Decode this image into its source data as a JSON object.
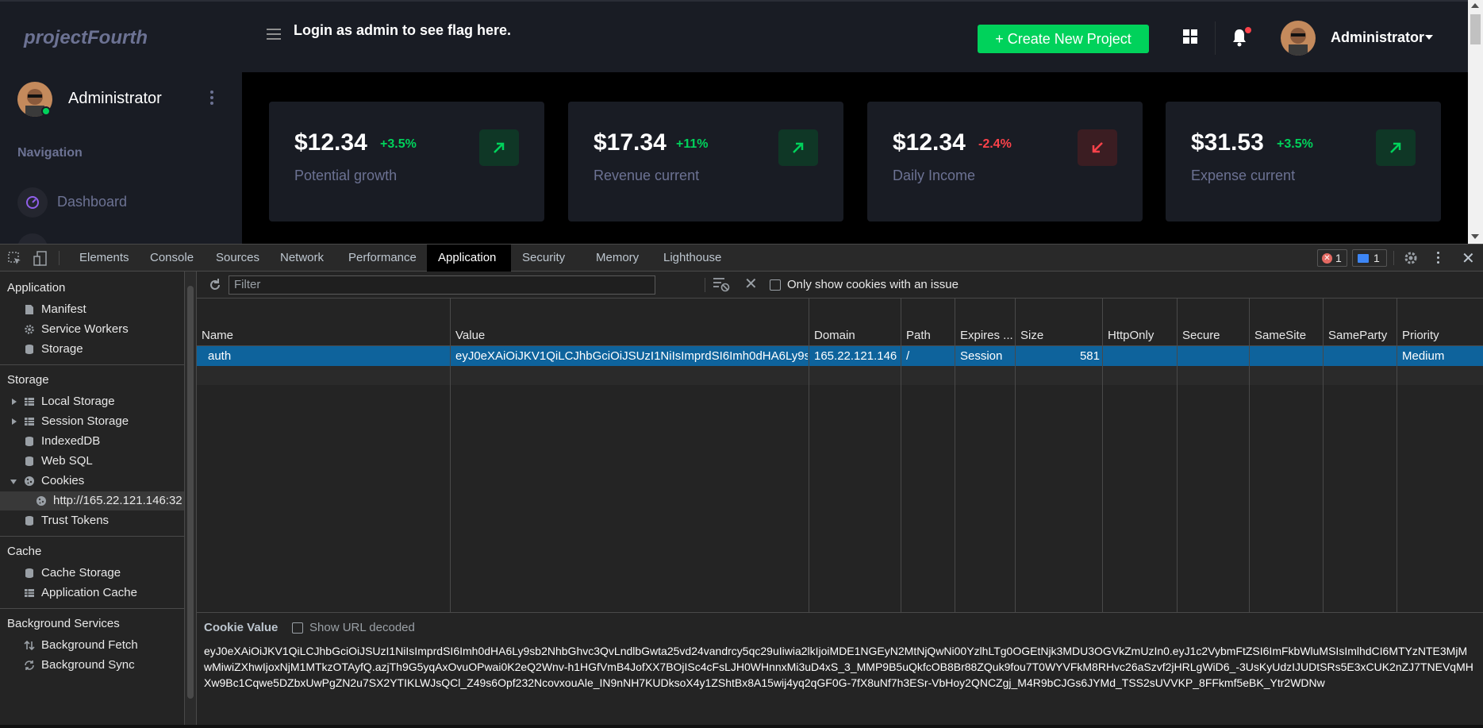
{
  "app": {
    "logo": "projectFourth",
    "flag_message": "Login as admin to see flag here.",
    "create_button": "+ Create New Project",
    "top_user": "Administrator",
    "sidebar": {
      "user_name": "Administrator",
      "section_label": "Navigation",
      "items": [
        {
          "label": "Dashboard"
        }
      ]
    },
    "cards": [
      {
        "amount": "$12.34",
        "change": "+3.5%",
        "label": "Potential growth",
        "trend": "up"
      },
      {
        "amount": "$17.34",
        "change": "+11%",
        "label": "Revenue current",
        "trend": "up"
      },
      {
        "amount": "$12.34",
        "change": "-2.4%",
        "label": "Daily Income",
        "trend": "down"
      },
      {
        "amount": "$31.53",
        "change": "+3.5%",
        "label": "Expense current",
        "trend": "up"
      }
    ],
    "colors": {
      "accent_green": "#00d25b",
      "accent_red": "#fc424a",
      "muted": "#6c7293",
      "panel": "#191c24"
    }
  },
  "devtools": {
    "tabs": [
      "Elements",
      "Console",
      "Sources",
      "Network",
      "Performance",
      "Application",
      "Security",
      "Memory",
      "Lighthouse"
    ],
    "active_tab": "Application",
    "error_count": "1",
    "message_count": "1",
    "left_panel": {
      "application_heading": "Application",
      "application_items": [
        "Manifest",
        "Service Workers",
        "Storage"
      ],
      "storage_heading": "Storage",
      "storage_items": [
        "Local Storage",
        "Session Storage",
        "IndexedDB",
        "Web SQL",
        "Cookies"
      ],
      "cookie_origin": "http://165.22.121.146:32",
      "trust_tokens": "Trust Tokens",
      "cache_heading": "Cache",
      "cache_items": [
        "Cache Storage",
        "Application Cache"
      ],
      "background_heading": "Background Services",
      "background_items": [
        "Background Fetch",
        "Background Sync"
      ]
    },
    "cookies": {
      "filter_placeholder": "Filter",
      "only_issues_label": "Only show cookies with an issue",
      "columns": [
        "Name",
        "Value",
        "Domain",
        "Path",
        "Expires ...",
        "Size",
        "HttpOnly",
        "Secure",
        "SameSite",
        "SameParty",
        "Priority"
      ],
      "rows": [
        {
          "name": "auth",
          "value": "eyJ0eXAiOiJKV1QiLCJhbGciOiJSUzI1NiIsImprdSI6Imh0dHA6Ly9s...",
          "domain": "165.22.121.146",
          "path": "/",
          "expires": "Session",
          "size": "581",
          "httponly": "",
          "secure": "",
          "samesite": "",
          "sameparty": "",
          "priority": "Medium"
        }
      ],
      "cookie_value_label": "Cookie Value",
      "show_url_decoded_label": "Show URL decoded",
      "cookie_value": "eyJ0eXAiOiJKV1QiLCJhbGciOiJSUzI1NiIsImprdSI6Imh0dHA6Ly9sb2NhbGhvc3QvLndlbGwta25vd24vandrcy5qc29uIiwia2lkIjoiMDE1NGEyN2MtNjQwNi00YzlhLTg0OGEtNjk3MDU3OGVkZmUzIn0.eyJ1c2VybmFtZSI6ImFkbWluMSIsImlhdCI6MTYzNTE3MjMwMiwiZXhwIjoxNjM1MTkzOTAyfQ.azjTh9G5yqAxOvuOPwai0K2eQ2Wnv-h1HGfVmB4JofXX7BOjISc4cFsLJH0WHnnxMi3uD4xS_3_MMP9B5uQkfcOB8Br88ZQuk9fou7T0WYVFkM8RHvc26aSzvf2jHRLgWiD6_-3UsKyUdzIJUDtSRs5E3xCUK2nZJ7TNEVqMHXw9Bc1Cqwe5DZbxUwPgZN2u7SX2YTIKLWJsQCl_Z49s6Opf232NcovxouAle_IN9nNH7KUDksoX4y1ZShtBx8A15wij4yq2qGF0G-7fX8uNf7h3ESr-VbHoy2QNCZgj_M4R9bCJGs6JYMd_TSS2sUVVKP_8FFkmf5eBK_Ytr2WDNw"
    }
  }
}
